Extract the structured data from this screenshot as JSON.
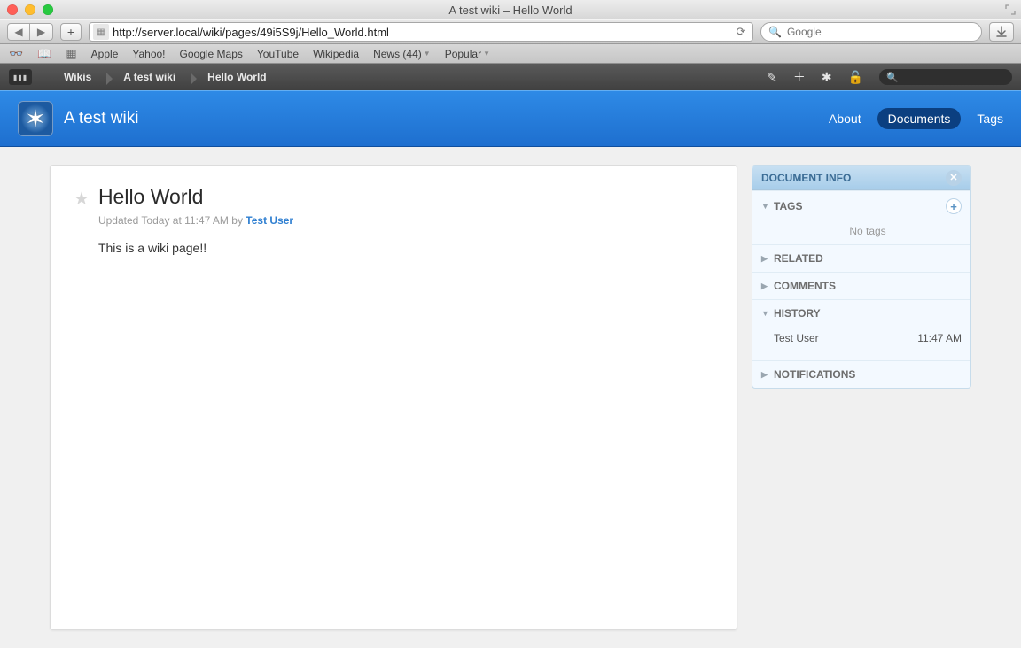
{
  "window": {
    "title": "A test wiki – Hello World"
  },
  "toolbar": {
    "url": "http://server.local/wiki/pages/49i5S9j/Hello_World.html",
    "search_placeholder": "Google"
  },
  "bookmarks": {
    "items": [
      "Apple",
      "Yahoo!",
      "Google Maps",
      "YouTube",
      "Wikipedia",
      "News (44)",
      "Popular"
    ]
  },
  "wikibar": {
    "crumbs": [
      "Wikis",
      "A test wiki",
      "Hello World"
    ]
  },
  "wikiheader": {
    "title": "A test wiki",
    "nav": {
      "about": "About",
      "documents": "Documents",
      "tags": "Tags"
    }
  },
  "doc": {
    "title": "Hello World",
    "meta_prefix": "Updated Today at 11:47 AM by ",
    "meta_user": "Test User",
    "body": "This is a wiki page!!"
  },
  "panel": {
    "title": "DOCUMENT INFO",
    "tags": {
      "label": "TAGS",
      "empty": "No tags"
    },
    "related": {
      "label": "RELATED"
    },
    "comments": {
      "label": "COMMENTS"
    },
    "history": {
      "label": "HISTORY",
      "user": "Test User",
      "time": "11:47 AM"
    },
    "notifications": {
      "label": "NOTIFICATIONS"
    }
  }
}
